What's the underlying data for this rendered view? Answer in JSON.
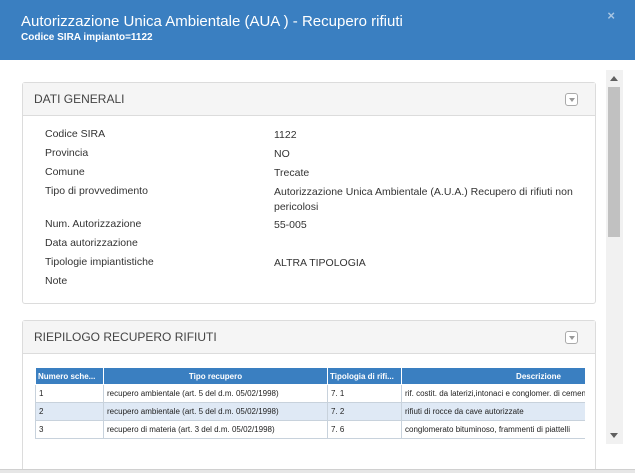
{
  "header": {
    "title": "Autorizzazione Unica Ambientale (AUA ) - Recupero rifiuti",
    "subtitle": "Codice SIRA impianto=1122",
    "close_icon": "×"
  },
  "general": {
    "title": "DATI GENERALI",
    "rows": [
      {
        "label": "Codice SIRA",
        "value": "1122"
      },
      {
        "label": "Provincia",
        "value": "NO"
      },
      {
        "label": "Comune",
        "value": "Trecate"
      },
      {
        "label": "Tipo di provvedimento",
        "value": "Autorizzazione Unica Ambientale (A.U.A.) Recupero di rifiuti non pericolosi"
      },
      {
        "label": "Num. Autorizzazione",
        "value": "55-005"
      },
      {
        "label": "Data autorizzazione",
        "value": ""
      },
      {
        "label": "Tipologie impiantistiche",
        "value": "ALTRA TIPOLOGIA"
      },
      {
        "label": "Note",
        "value": ""
      }
    ]
  },
  "recovery": {
    "title": "RIEPILOGO RECUPERO RIFIUTI",
    "columns": [
      "Numero sche...",
      "Tipo recupero",
      "Tipologia di rifi...",
      "Descrizione"
    ],
    "rows": [
      [
        "1",
        "recupero ambientale (art. 5 del d.m. 05/02/1998)",
        "7. 1",
        "rif. costit. da laterizi,intonaci e conglomer. di cemento"
      ],
      [
        "2",
        "recupero ambientale (art. 5 del d.m. 05/02/1998)",
        "7. 2",
        "rifiuti di rocce da cave autorizzate"
      ],
      [
        "3",
        "recupero di materia (art. 3 del d.m. 05/02/1998)",
        "7. 6",
        "conglomerato bituminoso, frammenti di piattelli"
      ]
    ]
  },
  "icons": {
    "close": "close-icon",
    "collapse": "chevron-down-icon"
  },
  "colors": {
    "header_bg": "#3a7fc1",
    "table_header_bg": "#3a7fc1",
    "alt_row_bg": "#dfe9f5"
  }
}
